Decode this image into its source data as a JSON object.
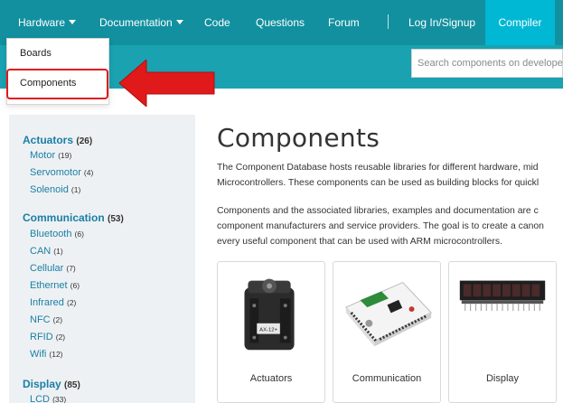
{
  "nav": {
    "items": [
      {
        "label": "Hardware",
        "dropdown": true
      },
      {
        "label": "Documentation",
        "dropdown": true
      },
      {
        "label": "Code",
        "dropdown": false
      },
      {
        "label": "Questions",
        "dropdown": false
      },
      {
        "label": "Forum",
        "dropdown": false
      },
      {
        "label": "Log In/Signup",
        "dropdown": false
      }
    ],
    "compiler_label": "Compiler"
  },
  "search": {
    "placeholder": "Search components on developer.mbed.org",
    "value": ""
  },
  "dropdown": {
    "items": [
      "Boards",
      "Components"
    ],
    "highlighted": "Components"
  },
  "sidebar": {
    "categories": [
      {
        "name": "Actuators",
        "count": "(26)",
        "items": [
          {
            "name": "Motor",
            "count": "(19)"
          },
          {
            "name": "Servomotor",
            "count": "(4)"
          },
          {
            "name": "Solenoid",
            "count": "(1)"
          }
        ]
      },
      {
        "name": "Communication",
        "count": "(53)",
        "items": [
          {
            "name": "Bluetooth",
            "count": "(6)"
          },
          {
            "name": "CAN",
            "count": "(1)"
          },
          {
            "name": "Cellular",
            "count": "(7)"
          },
          {
            "name": "Ethernet",
            "count": "(6)"
          },
          {
            "name": "Infrared",
            "count": "(2)"
          },
          {
            "name": "NFC",
            "count": "(2)"
          },
          {
            "name": "RFID",
            "count": "(2)"
          },
          {
            "name": "Wifi",
            "count": "(12)"
          }
        ]
      },
      {
        "name": "Display",
        "count": "(85)",
        "items": [
          {
            "name": "LCD",
            "count": "(33)"
          }
        ]
      }
    ]
  },
  "main": {
    "title": "Components",
    "paragraph1": [
      "The Component Database hosts reusable libraries for different hardware, mid",
      "Microcontrollers. These components can be used as building blocks for quickl"
    ],
    "paragraph2": [
      "Components and the associated libraries, examples and documentation are c",
      "component manufacturers and service providers. The goal is to create a canon",
      "every useful component that can be used with ARM microcontrollers."
    ],
    "cards": [
      {
        "label": "Actuators",
        "icon": "servo-motor-image",
        "badge": "AX-12+"
      },
      {
        "label": "Communication",
        "icon": "communication-shield-image"
      },
      {
        "label": "Display",
        "icon": "led-display-module-image"
      }
    ]
  },
  "colors": {
    "nav_bg": "#12909f",
    "banner_bg": "#1aa2b1",
    "compiler_bg": "#00b8d4",
    "link": "#1a7fa6",
    "highlight_red": "#e0191a",
    "sidebar_bg": "#eef1f3"
  }
}
